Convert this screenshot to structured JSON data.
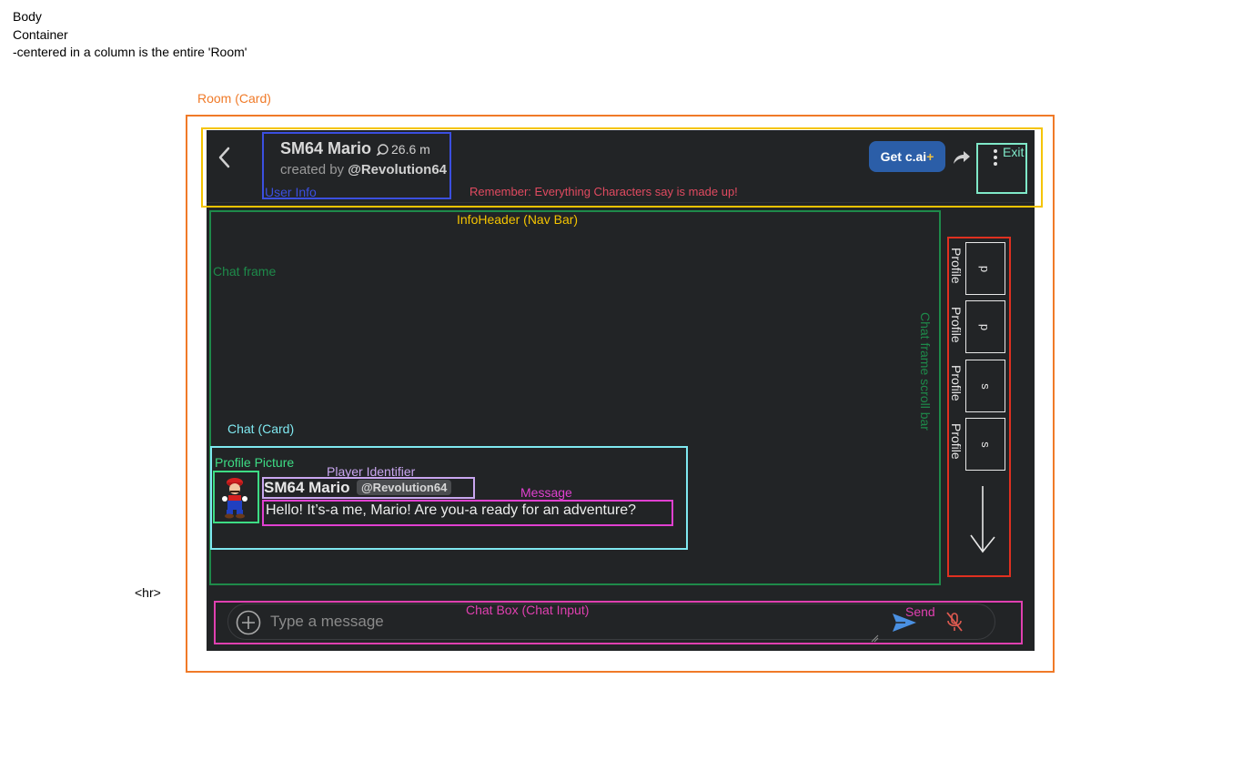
{
  "notes": {
    "body": "Body",
    "container": "Container",
    "centered": "-centered in a column is the entire 'Room'",
    "hr": "<hr>"
  },
  "labels": {
    "room": "Room (Card)",
    "user_info": "User Info",
    "exit": "Exit",
    "reminder": "Remember: Everything Characters say is made up!",
    "info_header": "InfoHeader (Nav Bar)",
    "chat_frame": "Chat frame",
    "chat_frame_scroll": "Chat frame scroll bar",
    "chat_card": "Chat  (Card)",
    "profile_picture": "Profile Picture",
    "player_identifier": "Player Identifier",
    "message": "Message",
    "chat_box": "Chat Box (Chat Input)",
    "send": "Send"
  },
  "header": {
    "title": "SM64 Mario",
    "chat_count": "26.6 m",
    "created_by_prefix": "created by",
    "creator": "@Revolution64",
    "get_button_main": "Get c.ai",
    "get_button_plus": "+"
  },
  "scrollbar": {
    "profiles": [
      {
        "label": "Profile",
        "letter": "p"
      },
      {
        "label": "Profile",
        "letter": "p"
      },
      {
        "label": "Profile",
        "letter": "s"
      },
      {
        "label": "Profile",
        "letter": "s"
      }
    ]
  },
  "chat": {
    "name": "SM64 Mario",
    "handle": "@Revolution64",
    "message": "Hello! It’s-a me, Mario! Are you-a ready for an adventure?"
  },
  "input": {
    "placeholder": "Type a message"
  },
  "colors": {
    "room": "#f07a28",
    "nav": "#f5c400",
    "user_info": "#3b4fe0",
    "exit": "#7fe8c8",
    "chat_frame": "#1e8a4a",
    "chat_card": "#7fe8f0",
    "profile_pic": "#3ddc84",
    "player_id": "#c9a6f0",
    "message": "#e040d0",
    "chat_box": "#e040b0",
    "scroll": "#e03020",
    "reminder": "#e04a60",
    "accent": "#2b5ea8"
  }
}
